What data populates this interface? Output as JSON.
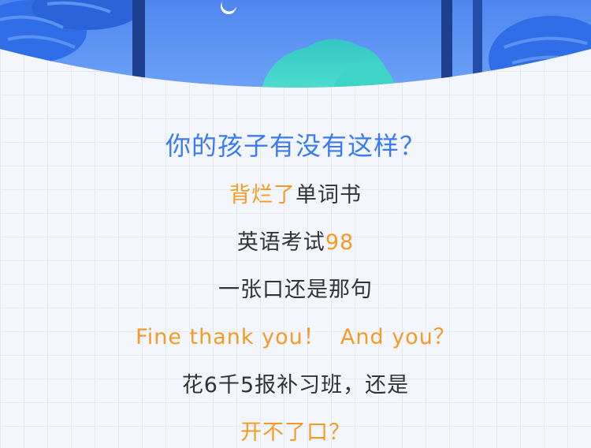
{
  "colors": {
    "accent_blue": "#3b7af0",
    "accent_orange": "#f59a23",
    "text": "#333333",
    "background": "#f3f7fd"
  },
  "header": {
    "illustration": "blue-forest-banner-illustration"
  },
  "headline": "你的孩子有没有这样？",
  "lines": [
    {
      "highlight": "背烂了",
      "rest": "单词书"
    },
    {
      "text": "英语考试",
      "highlight": "98"
    },
    {
      "text": "一张口还是那句"
    },
    {
      "highlight": "Fine thank you！  And you？"
    },
    {
      "text": "花6千5报补习班，还是"
    },
    {
      "highlight": "开不了口？"
    }
  ]
}
